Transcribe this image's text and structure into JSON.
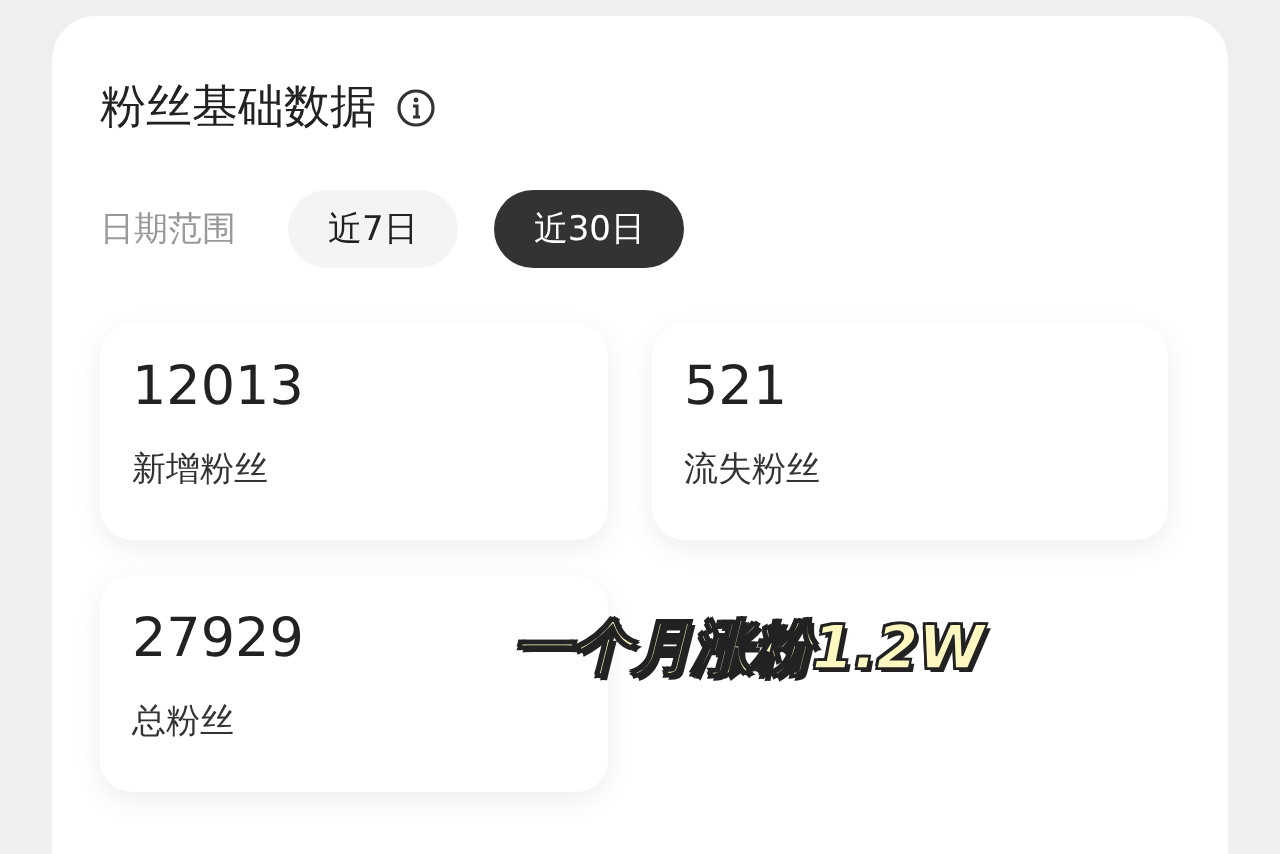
{
  "title": "粉丝基础数据",
  "date_range": {
    "label": "日期范围",
    "options": [
      {
        "label": "近7日",
        "selected": false
      },
      {
        "label": "近30日",
        "selected": true
      }
    ]
  },
  "stats": [
    {
      "value": "12013",
      "label": "新增粉丝"
    },
    {
      "value": "521",
      "label": "流失粉丝"
    },
    {
      "value": "27929",
      "label": "总粉丝"
    }
  ],
  "caption": "一个月涨粉1.2W"
}
